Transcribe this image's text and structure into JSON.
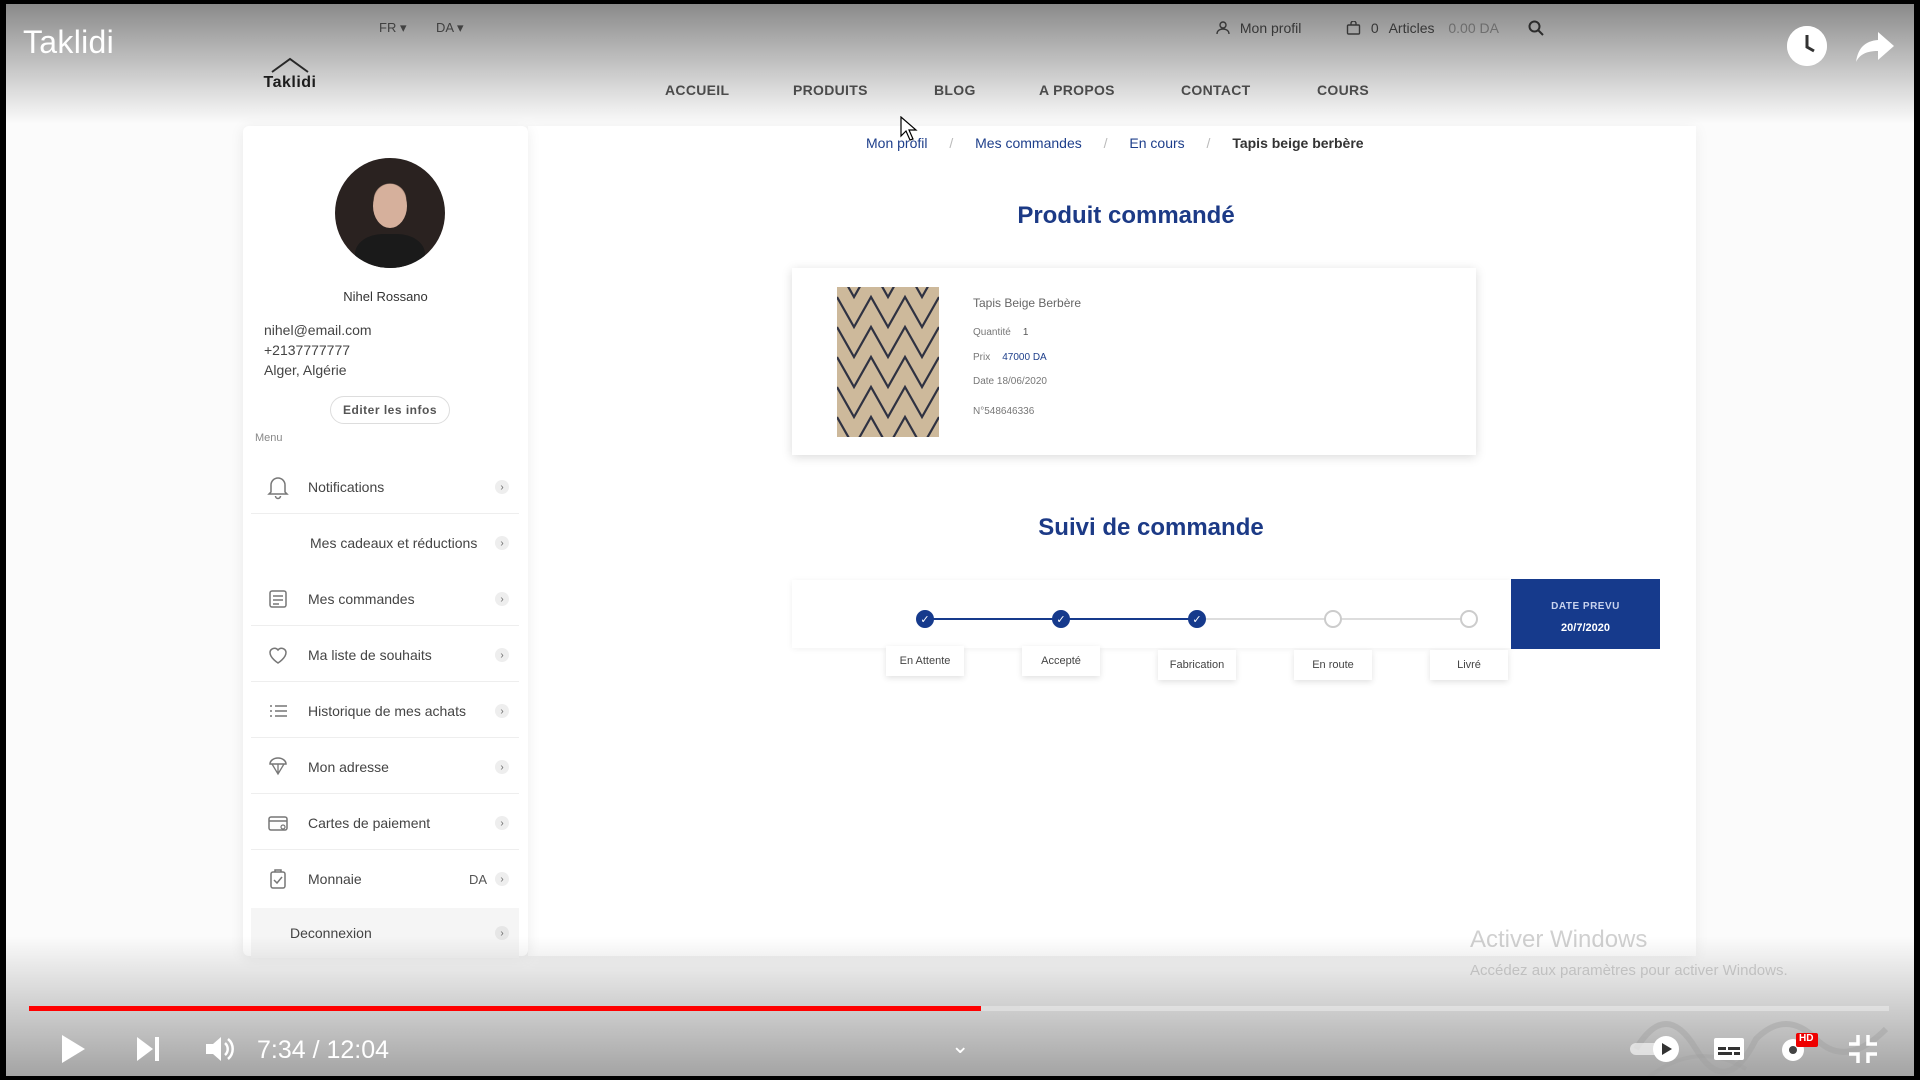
{
  "video": {
    "title": "Taklidi",
    "time": "7:34 / 12:04",
    "progress_played": 0.512,
    "progress_buffered": 0.533,
    "hd_badge": "HD"
  },
  "site": {
    "logo": "Taklidi",
    "lang_fr": "FR",
    "currency_da": "DA",
    "profile_link": "Mon profil",
    "cart_count": "0",
    "cart_label": "Articles",
    "cart_total": "0.00 DA",
    "nav": [
      "ACCUEIL",
      "PRODUITS",
      "BLOG",
      "A PROPOS",
      "CONTACT",
      "COURS"
    ]
  },
  "profile": {
    "name": "Nihel Rossano",
    "email": "nihel@email.com",
    "phone": "+2137777777",
    "location": "Alger, Algérie",
    "edit_label": "Editer les infos",
    "menu_label": "Menu"
  },
  "menu": [
    {
      "label": "Notifications"
    },
    {
      "label": "Mes cadeaux et réductions"
    },
    {
      "label": "Mes commandes"
    },
    {
      "label": "Ma liste de souhaits"
    },
    {
      "label": "Historique de mes achats"
    },
    {
      "label": "Mon adresse"
    },
    {
      "label": "Cartes de paiement"
    },
    {
      "label": "Monnaie",
      "extra": "DA"
    }
  ],
  "logout_label": "Deconnexion",
  "breadcrumb": [
    "Mon profil",
    "Mes commandes",
    "En cours",
    "Tapis beige berbère"
  ],
  "order": {
    "section_title": "Produit commandé",
    "product_name": "Tapis Beige Berbère",
    "qty_label": "Quantité",
    "qty_value": "1",
    "price_label": "Prix",
    "price_value": "47000 DA",
    "date": "Date 18/06/2020",
    "number": "N°548646336"
  },
  "tracking": {
    "section_title": "Suivi de commande",
    "steps": [
      {
        "label": "En Attente",
        "done": true
      },
      {
        "label": "Accepté",
        "done": true
      },
      {
        "label": "Fabrication",
        "done": true
      },
      {
        "label": "En route",
        "done": false
      },
      {
        "label": "Livré",
        "done": false
      }
    ],
    "date_title": "DATE PREVU",
    "date_value": "20/7/2020"
  },
  "watermark": {
    "line1": "Activer Windows",
    "line2": "Accédez aux paramètres pour activer Windows."
  },
  "colors": {
    "accent": "#163a8c",
    "progress": "#ff0000"
  }
}
